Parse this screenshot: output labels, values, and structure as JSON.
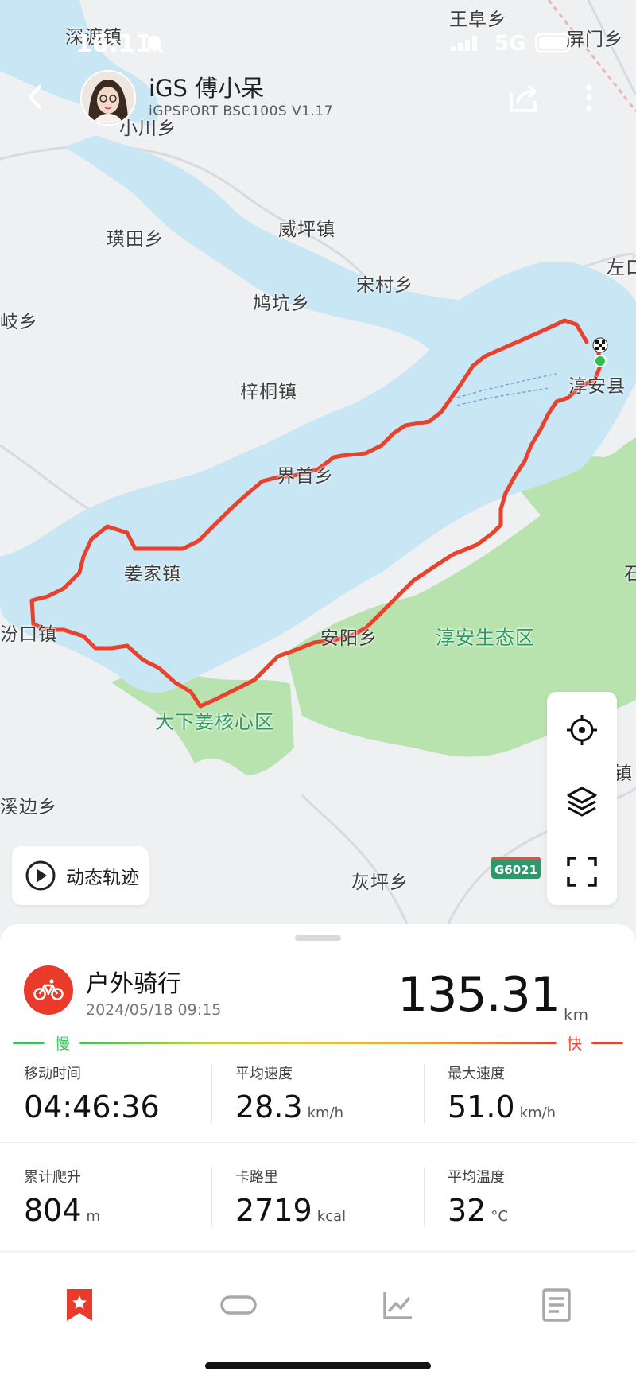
{
  "status_bar": {
    "time": "16:11",
    "network": "5G"
  },
  "header": {
    "title": "iGS 傅小呆",
    "subtitle": "iGPSPORT BSC100S V1.17"
  },
  "icons": {
    "back": "chevron-left-icon",
    "share": "share-icon",
    "more": "more-vertical-icon",
    "locate": "locate-icon",
    "layers": "layers-icon",
    "fullscreen": "fullscreen-icon",
    "play": "play-icon",
    "bike": "bicycle-icon"
  },
  "map": {
    "places": [
      "深渡镇",
      "王阜乡",
      "屏门乡",
      "小川乡",
      "璜田乡",
      "威坪镇",
      "左口",
      "宋村乡",
      "鸠坑乡",
      "岐乡",
      "梓桐镇",
      "淳安县",
      "界首乡",
      "姜家镇",
      "石",
      "汾口镇",
      "安阳乡",
      "淳安生态区",
      "大下姜核心区",
      "镇",
      "溪边乡",
      "灰坪乡"
    ],
    "road_badge": "G6021",
    "track_button": "动态轨迹",
    "route_color": "#e8412c"
  },
  "activity": {
    "type": "户外骑行",
    "datetime": "2024/05/18 09:15",
    "distance": "135.31",
    "distance_unit": "km",
    "speed_scale": {
      "slow": "慢",
      "fast": "快"
    }
  },
  "stats": [
    {
      "label": "移动时间",
      "value": "04:46:36",
      "unit": ""
    },
    {
      "label": "平均速度",
      "value": "28.3",
      "unit": "km/h"
    },
    {
      "label": "最大速度",
      "value": "51.0",
      "unit": "km/h"
    },
    {
      "label": "累计爬升",
      "value": "804",
      "unit": "m"
    },
    {
      "label": "卡路里",
      "value": "2719",
      "unit": "kcal"
    },
    {
      "label": "平均温度",
      "value": "32",
      "unit": "°C"
    }
  ],
  "tabs": [
    {
      "name": "summary",
      "icon": "bookmark-star-icon",
      "active": true
    },
    {
      "name": "device",
      "icon": "capsule-icon",
      "active": false
    },
    {
      "name": "charts",
      "icon": "line-chart-icon",
      "active": false
    },
    {
      "name": "details",
      "icon": "document-icon",
      "active": false
    }
  ],
  "colors": {
    "accent": "#ea3a2a",
    "water": "#c9e6f5",
    "park": "#b8e3ae",
    "slow": "#3fbf5a",
    "fast": "#e8412c"
  }
}
